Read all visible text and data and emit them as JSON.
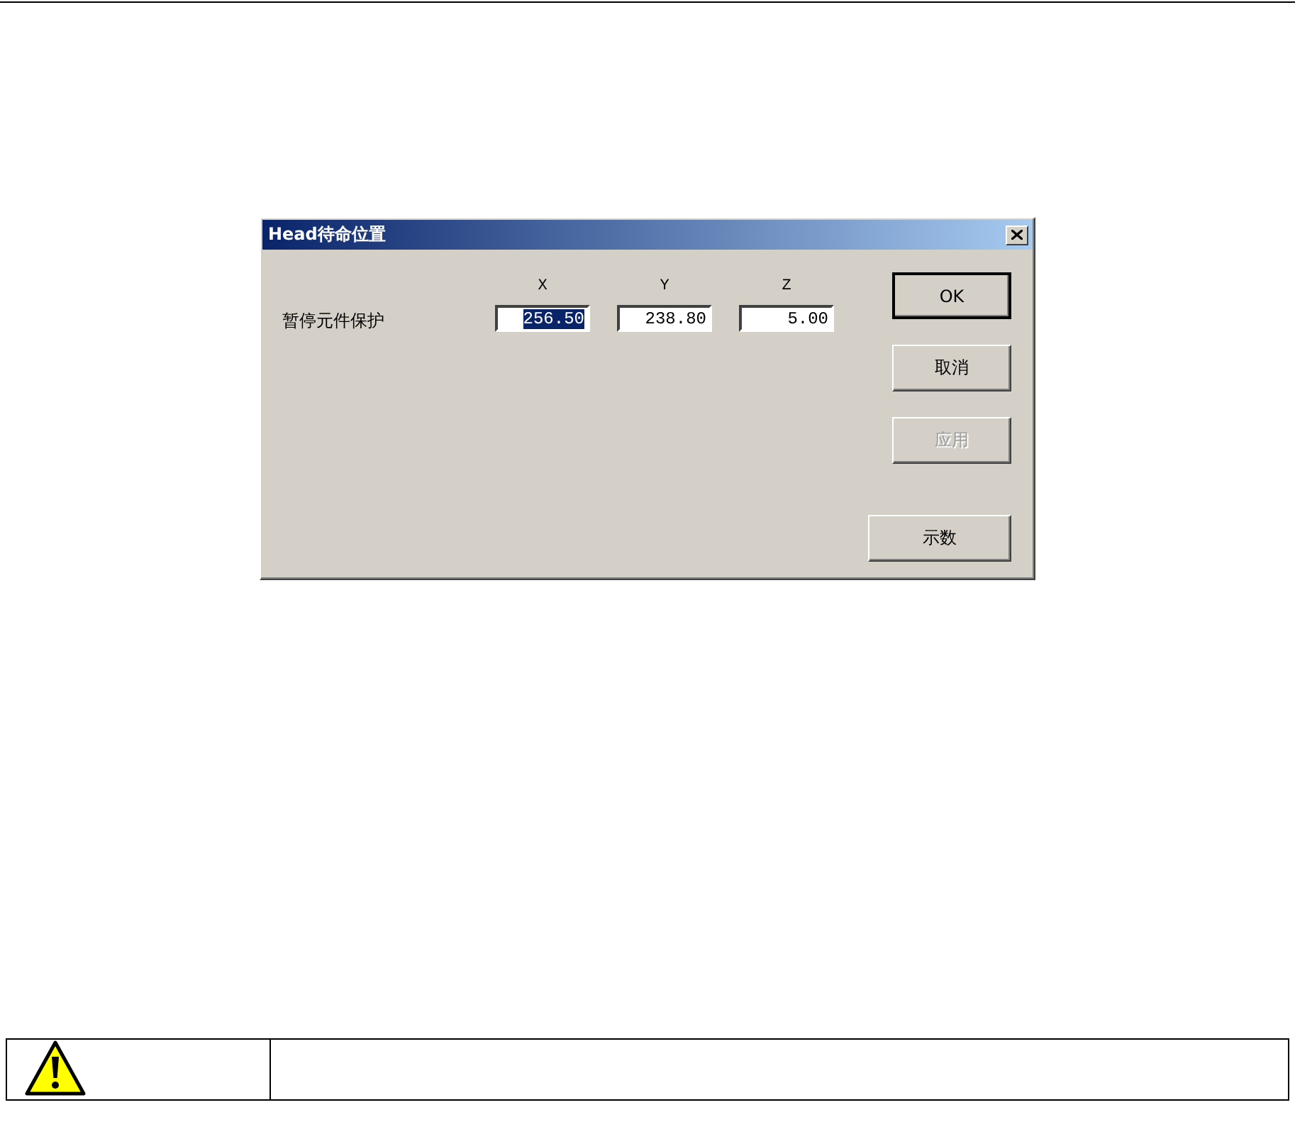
{
  "dialog": {
    "title": "Head待命位置",
    "row_label": "暂停元件保护",
    "fields": [
      {
        "header": "X",
        "value": "256.50",
        "selected": true
      },
      {
        "header": "Y",
        "value": "238.80",
        "selected": false
      },
      {
        "header": "Z",
        "value": "5.00",
        "selected": false
      }
    ],
    "buttons": [
      {
        "label": "OK",
        "default": true,
        "disabled": false,
        "kind": "narrow"
      },
      {
        "label": "取消",
        "default": false,
        "disabled": false,
        "kind": "narrow"
      },
      {
        "label": "应用",
        "default": false,
        "disabled": true,
        "kind": "narrow"
      },
      {
        "label": "示数",
        "default": false,
        "disabled": false,
        "kind": "wide"
      }
    ]
  }
}
